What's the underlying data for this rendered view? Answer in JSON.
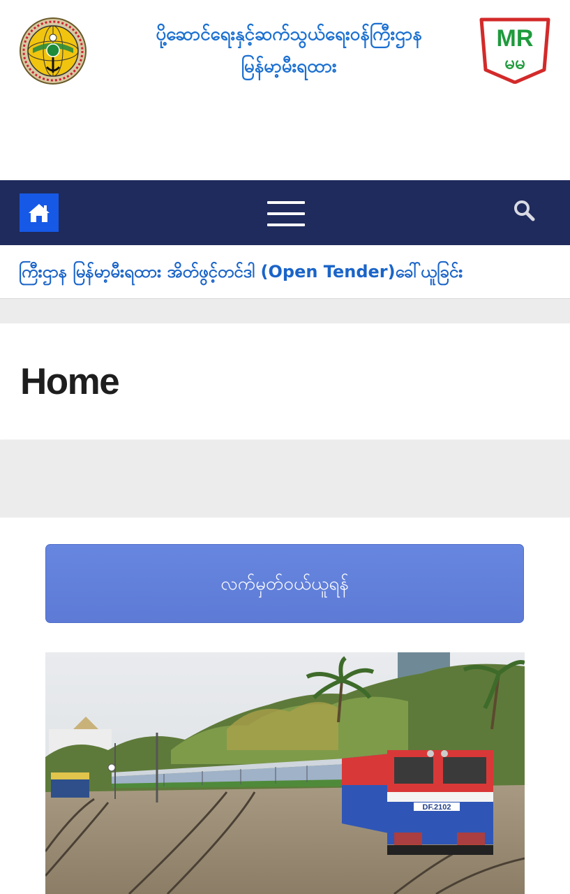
{
  "header": {
    "ministry_line1": "ပို့ဆောင်ရေးနှင့်ဆက်သွယ်ရေးဝန်ကြီးဌာန",
    "ministry_line2": "မြန်မာ့မီးရထား",
    "left_logo_icon": "ministry-emblem-icon",
    "right_logo_icon": "mr-logo-icon",
    "right_logo_text": "MR",
    "right_logo_subtext": "မမ"
  },
  "navbar": {
    "home_icon": "home-icon",
    "menu_icon": "hamburger-menu-icon",
    "search_icon": "search-icon"
  },
  "ticker": {
    "text": "ကြီးဌာန မြန်မာ့မီးရထား အိတ်ဖွင့်တင်ဒါ (Open Tender)ခေါ်ယူခြင်း"
  },
  "page": {
    "title": "Home"
  },
  "content": {
    "login_button_label": "လက်မှတ်ဝယ်ယူရန်",
    "train_image_label": "DF.2102"
  },
  "colors": {
    "navbar": "#1f2b5c",
    "home_button": "#1659e6",
    "link_blue": "#1a64c8",
    "login_button": "#6283dc",
    "logo_red": "#d32a2a",
    "logo_green": "#1f9a3d"
  }
}
